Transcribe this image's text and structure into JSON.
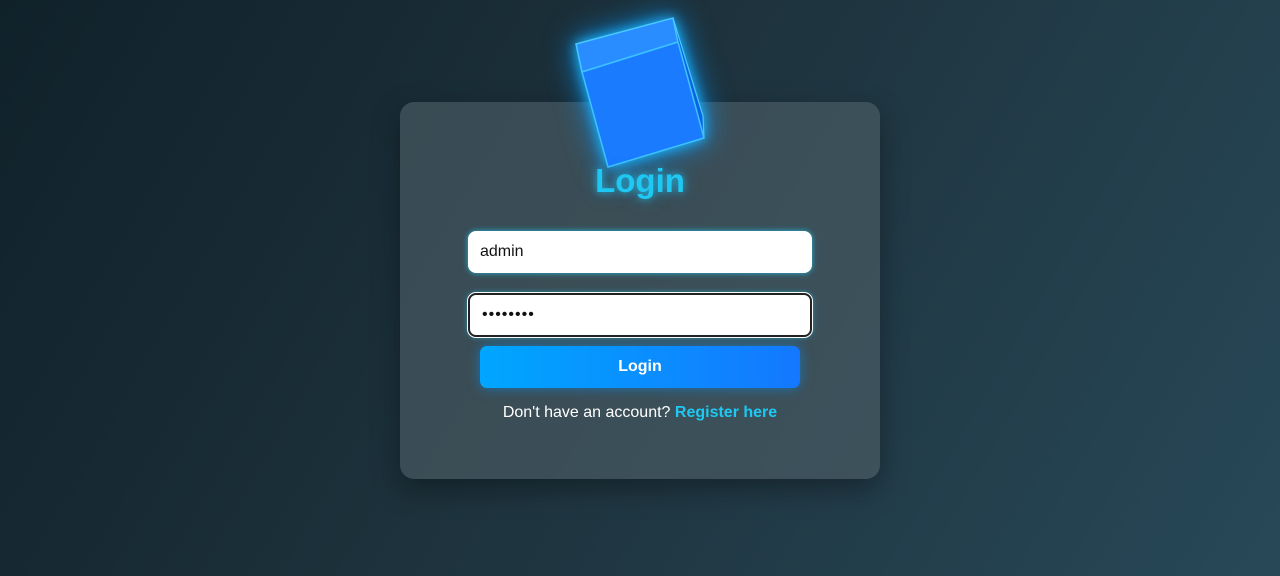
{
  "login": {
    "title": "Login",
    "username_value": "admin",
    "password_value": "password",
    "button_label": "Login",
    "footer_text": "Don't have an account?",
    "register_link": "Register here"
  },
  "icons": {
    "logo": "cube-icon"
  },
  "colors": {
    "accent": "#1ec8f2",
    "button_start": "#00a6ff",
    "button_end": "#1478ff",
    "cube": "#1a7bff"
  }
}
